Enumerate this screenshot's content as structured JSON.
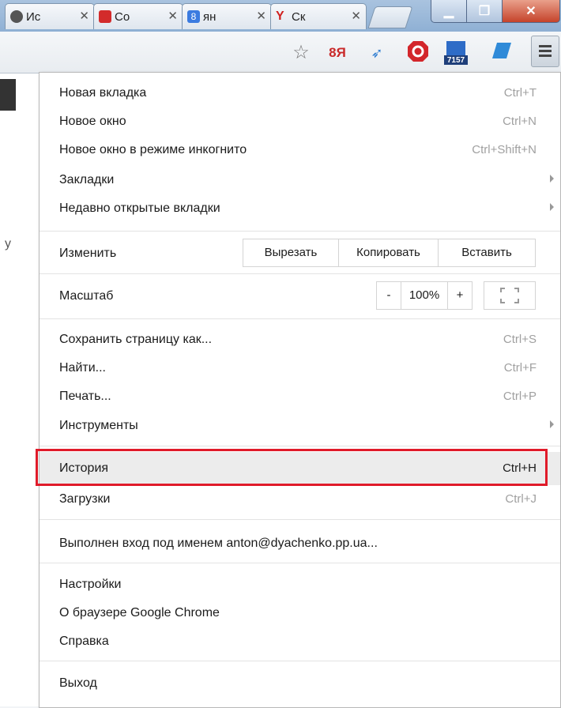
{
  "tabs": [
    {
      "label": "Ис",
      "icon": "gear-tab-icon"
    },
    {
      "label": "Со",
      "icon": "car-tab-icon"
    },
    {
      "label": "ян",
      "icon": "vk-tab-icon"
    },
    {
      "label": "Ск",
      "icon": "yandex-tab-icon"
    }
  ],
  "toolbar": {
    "ext_badge": "7157"
  },
  "menu": {
    "group1": [
      {
        "label": "Новая вкладка",
        "shortcut": "Ctrl+T"
      },
      {
        "label": "Новое окно",
        "shortcut": "Ctrl+N"
      },
      {
        "label": "Новое окно в режиме инкогнито",
        "shortcut": "Ctrl+Shift+N"
      },
      {
        "label": "Закладки",
        "shortcut": ""
      },
      {
        "label": "Недавно открытые вкладки",
        "shortcut": ""
      }
    ],
    "edit": {
      "label": "Изменить",
      "cut": "Вырезать",
      "copy": "Копировать",
      "paste": "Вставить"
    },
    "zoom": {
      "label": "Масштаб",
      "minus": "-",
      "value": "100%",
      "plus": "+"
    },
    "group3": [
      {
        "label": "Сохранить страницу как...",
        "shortcut": "Ctrl+S"
      },
      {
        "label": "Найти...",
        "shortcut": "Ctrl+F"
      },
      {
        "label": "Печать...",
        "shortcut": "Ctrl+P"
      },
      {
        "label": "Инструменты",
        "shortcut": ""
      }
    ],
    "history": {
      "label": "История",
      "shortcut": "Ctrl+H"
    },
    "downloads": {
      "label": "Загрузки",
      "shortcut": "Ctrl+J"
    },
    "signed_in": "Выполнен вход под именем anton@dyachenko.pp.ua...",
    "group5": [
      {
        "label": "Настройки"
      },
      {
        "label": "О браузере Google Chrome"
      },
      {
        "label": "Справка"
      }
    ],
    "exit": "Выход"
  },
  "page_hint": "у"
}
